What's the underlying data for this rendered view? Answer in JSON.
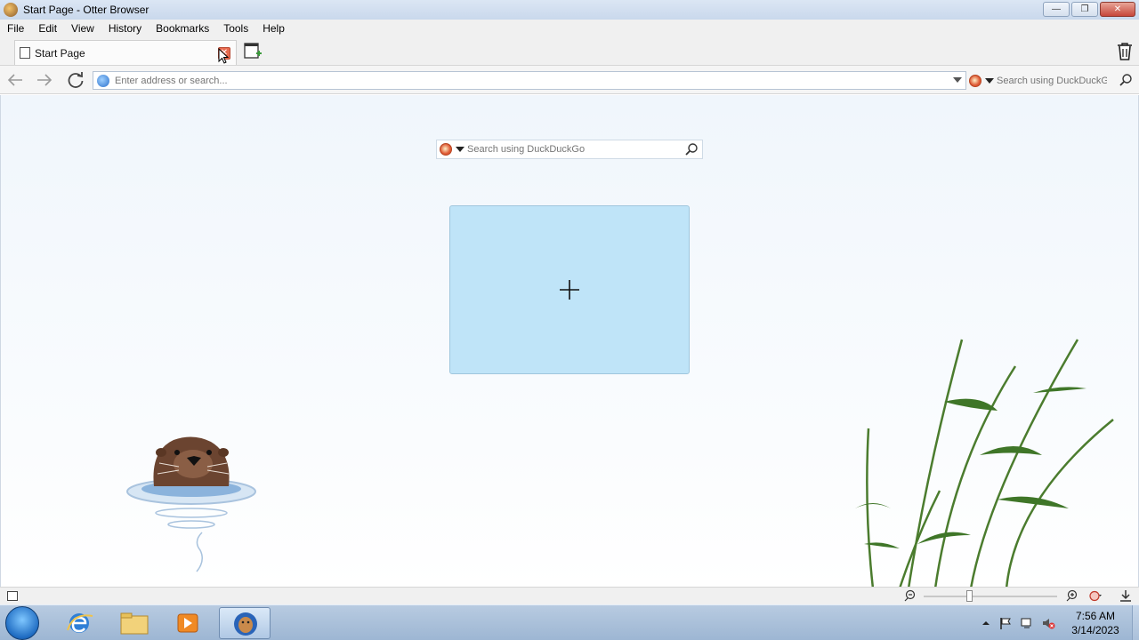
{
  "window": {
    "title": "Start Page - Otter Browser",
    "controls": {
      "minimize": "—",
      "restore": "❐",
      "close": "✕"
    }
  },
  "menu": [
    "File",
    "Edit",
    "View",
    "History",
    "Bookmarks",
    "Tools",
    "Help"
  ],
  "tabs": [
    {
      "label": "Start Page",
      "close": "✕"
    }
  ],
  "navigation": {
    "address_placeholder": "Enter address or search...",
    "search_placeholder": "Search using DuckDuckGo"
  },
  "start_page": {
    "search_placeholder": "Search using DuckDuckGo",
    "add_tile_icon": "plus-icon"
  },
  "taskbar": {
    "time": "7:56 AM",
    "date": "3/14/2023",
    "apps": [
      "internet-explorer-icon",
      "file-explorer-icon",
      "media-player-icon",
      "otter-browser-icon"
    ]
  }
}
